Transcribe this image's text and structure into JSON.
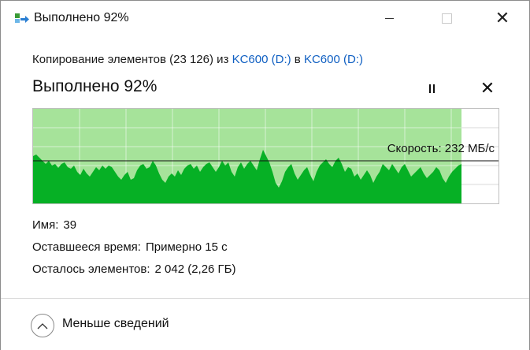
{
  "window": {
    "title": "Выполнено 92%"
  },
  "copy_info": {
    "prefix": "Копирование элементов (23 126) из ",
    "source": "KC600 (D:)",
    "middle": " в ",
    "destination": "KC600 (D:)"
  },
  "status": {
    "title": "Выполнено 92%",
    "progress_percent": 92
  },
  "speed": {
    "label": "Скорость: 232 МБ/с"
  },
  "details": {
    "name_label": "Имя:",
    "name_value": "39",
    "time_label": "Оставшееся время:",
    "time_value": "Примерно 15 с",
    "items_label": "Осталось элементов:",
    "items_value": "2 042 (2,26 ГБ)"
  },
  "footer": {
    "toggle_label": "Меньше сведений"
  },
  "colors": {
    "progress_fill": "#a6e39a",
    "graph_fill": "#06b025",
    "link": "#0f5fc2"
  },
  "icons": {
    "title": "copy-arrow-icon",
    "pause": "pause-icon",
    "cancel": "close-icon",
    "toggle": "chevron-up-icon"
  }
}
